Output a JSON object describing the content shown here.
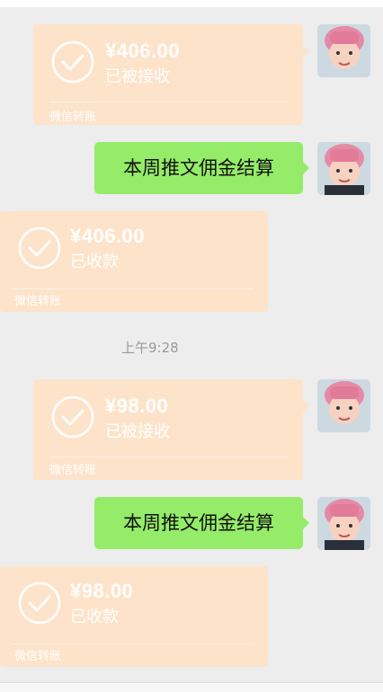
{
  "messages": [
    {
      "type": "transfer",
      "side": "right",
      "amount": "¥406.00",
      "status": "已被接收",
      "label": "微信转账"
    },
    {
      "type": "text",
      "side": "right",
      "text": "本周推文佣金结算"
    },
    {
      "type": "transfer",
      "side": "left",
      "amount": "¥406.00",
      "status": "已收款",
      "label": "微信转账"
    },
    {
      "type": "time",
      "text": "上午9:28"
    },
    {
      "type": "transfer",
      "side": "right",
      "amount": "¥98.00",
      "status": "已被接收",
      "label": "微信转账"
    },
    {
      "type": "text",
      "side": "right",
      "text": "本周推文佣金结算"
    },
    {
      "type": "transfer",
      "side": "left",
      "amount": "¥98.00",
      "status": "已收款",
      "label": "微信转账"
    }
  ],
  "colors": {
    "background": "#ededed",
    "transfer_bubble": "#fde3c9",
    "text_bubble": "#95ec69",
    "time_text": "#9a9a9a"
  },
  "icons": {
    "check": "check-circle-icon",
    "avatar": "user-avatar"
  }
}
